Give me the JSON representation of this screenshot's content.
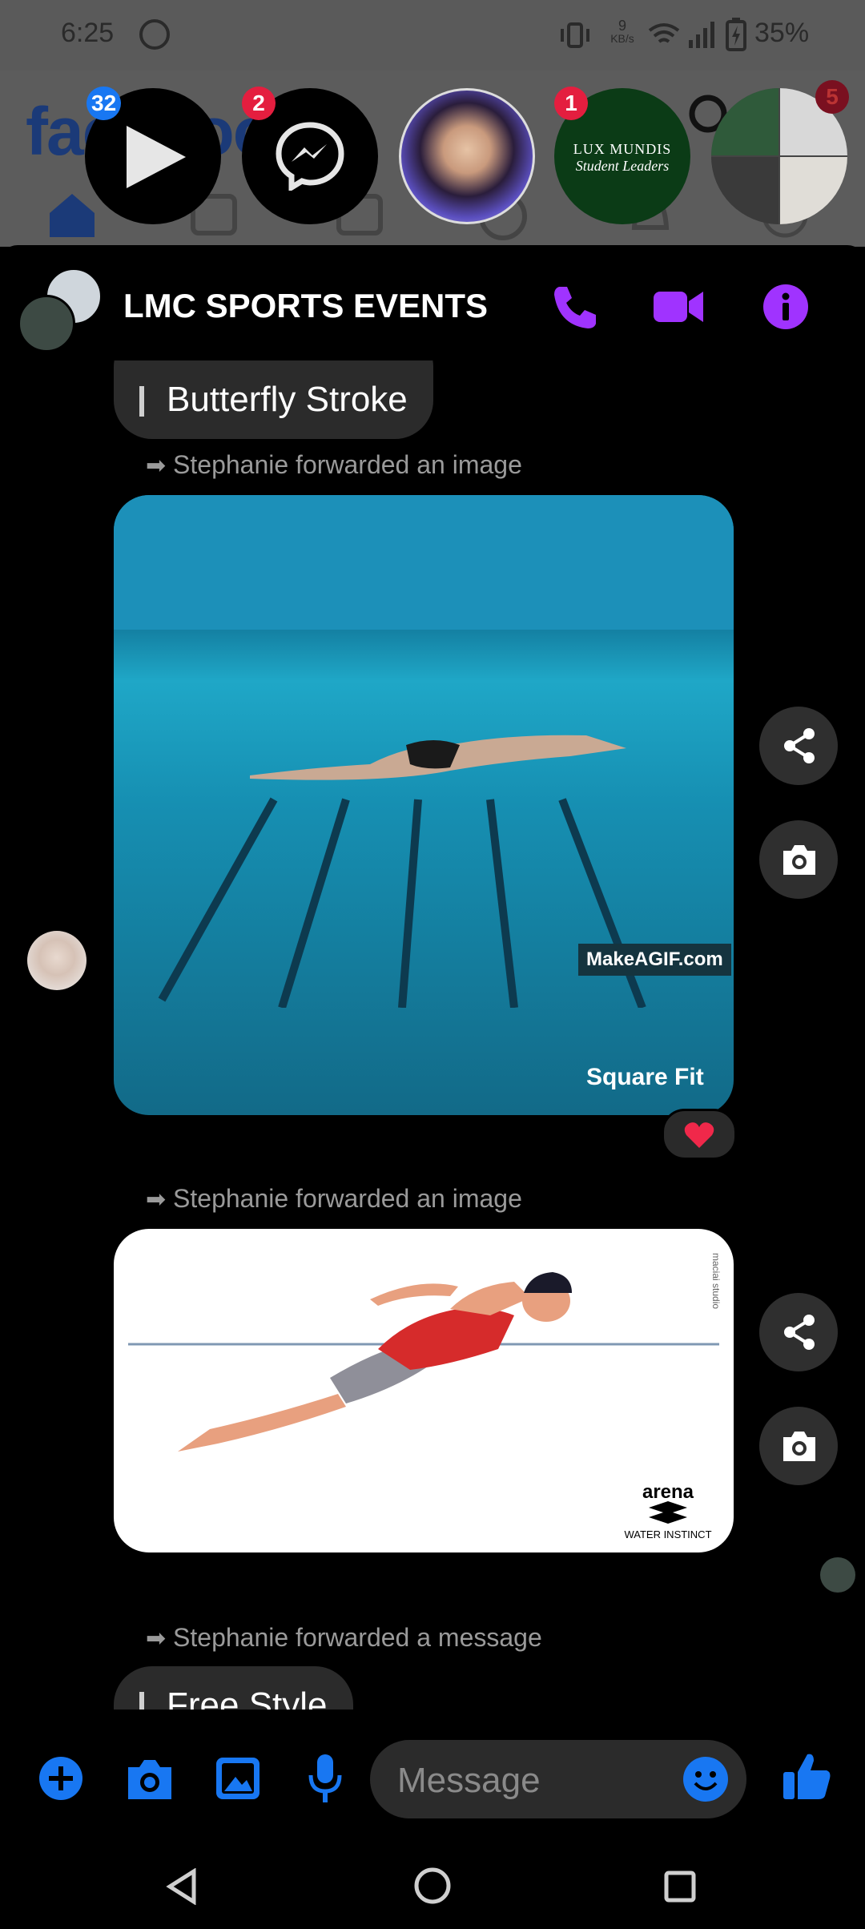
{
  "status_bar": {
    "time": "6:25",
    "network_speed_value": "9",
    "network_speed_unit": "KB/s",
    "battery": "35%"
  },
  "facebook_header": {
    "logo_text": "facebook"
  },
  "chat_heads": {
    "videos_badge": "32",
    "messenger_badge": "2",
    "lux_mundis_badge": "1",
    "lux_mundis_line1": "LUX MUNDIS",
    "lux_mundis_line2": "Student Leaders",
    "group_badge": "5"
  },
  "chat": {
    "title": "LMC SPORTS EVENTS",
    "accent_color": "#a033ff",
    "messages": {
      "butterfly_label": "Butterfly Stroke",
      "forward1": "Stephanie forwarded an image",
      "gif_watermark": "MakeAGIF.com",
      "gif_caption": "Square Fit",
      "reaction": "heart",
      "forward2": "Stephanie forwarded an image",
      "illus_side_text": "maciai studio",
      "illus_brand": "arena",
      "illus_tagline": "WATER INSTINCT",
      "forward3": "Stephanie forwarded a message",
      "freestyle_label": "Free Style"
    }
  },
  "composer": {
    "message_placeholder": "Message",
    "accent_color": "#1877f2"
  }
}
